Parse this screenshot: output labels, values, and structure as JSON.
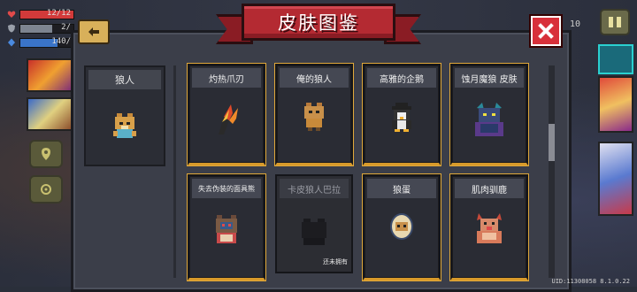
{
  "title": "皮肤图鉴",
  "colors": {
    "panel": "#3b3e49",
    "banner": "#b42a32",
    "owned_border": "#d89a2a",
    "close": "#d8303a",
    "accent": "#d8b05a"
  },
  "hud": {
    "hp": {
      "text": "12/12",
      "fraction": 1.0,
      "icon": "heart-icon"
    },
    "armor": {
      "text": "2/",
      "fraction": 0.6,
      "icon": "shield-icon"
    },
    "energy": {
      "text": "140/",
      "fraction": 0.7,
      "icon": "energy-icon"
    }
  },
  "top_right_number": "10",
  "character": {
    "name": "狼人"
  },
  "skins": [
    {
      "name": "灼热爪刃",
      "owned": true
    },
    {
      "name": "俺的狼人",
      "owned": true
    },
    {
      "name": "高雅的企鹅",
      "owned": true
    },
    {
      "name": "蚀月魔狼 皮肤",
      "owned": true
    },
    {
      "name": "失去伪装的面具熊",
      "owned": true
    },
    {
      "name": "卡皮狼人巴拉",
      "owned": false,
      "note": "还未拥有"
    },
    {
      "name": "狼蛋",
      "owned": true
    },
    {
      "name": "肌肉驯鹿",
      "owned": true
    }
  ],
  "icons": {
    "back": "back-arrow-icon",
    "close": "close-icon",
    "pause": "pause-icon"
  },
  "uid": "UID:11308058  8.1.0.22"
}
